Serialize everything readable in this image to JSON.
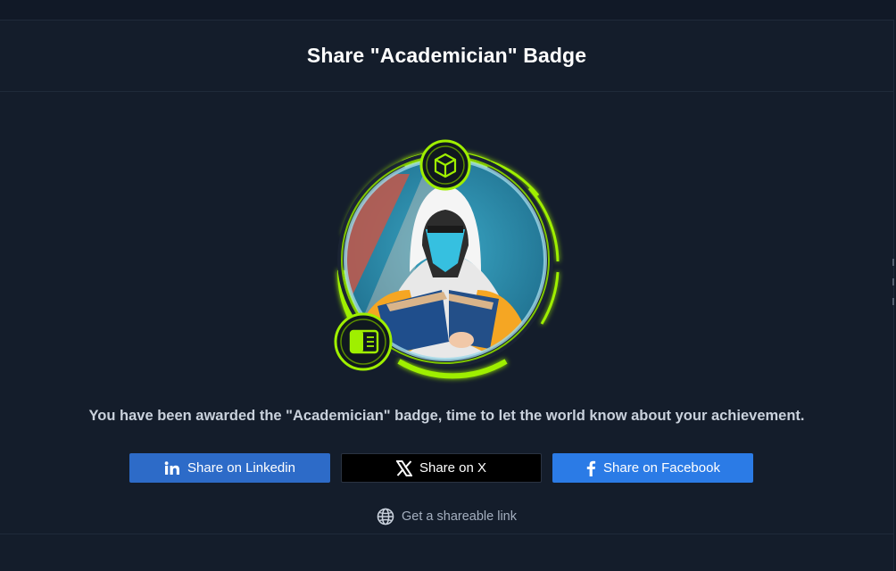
{
  "modal": {
    "title": "Share \"Academician\" Badge",
    "message": "You have been awarded the \"Academician\" badge, time to let the world know about your achievement."
  },
  "badge": {
    "name": "Academician",
    "icons": [
      "cube-icon",
      "card-icon"
    ],
    "colors": {
      "ring": "#9fef00",
      "ring_dark": "#5a8c00",
      "sky": "#2f8fb0",
      "robe": "#f2f2f2",
      "mask": "#36c0e0",
      "book": "#1f4e8c",
      "sleeve": "#f5a623"
    }
  },
  "buttons": {
    "linkedin": {
      "label": "Share on Linkedin",
      "icon": "linkedin-icon",
      "color": "#2d6bc8"
    },
    "x": {
      "label": "Share on X",
      "icon": "x-icon",
      "color": "#000000"
    },
    "facebook": {
      "label": "Share on Facebook",
      "icon": "facebook-icon",
      "color": "#2b7be6"
    }
  },
  "share_link": {
    "label": "Get a shareable link",
    "icon": "globe-icon"
  }
}
